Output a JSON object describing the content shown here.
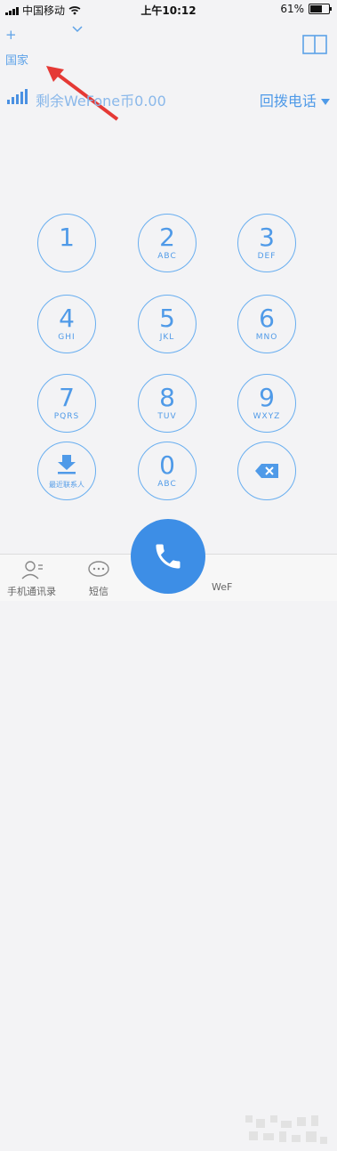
{
  "status_bar": {
    "carrier": "中国移动",
    "time": "上午10:12",
    "battery": "61%"
  },
  "header": {
    "plus": "+",
    "country": "国家"
  },
  "balance_row": {
    "balance_text": "剩余WeFone币0.00",
    "callback_text": "回拨电话"
  },
  "keypad": [
    {
      "digit": "1",
      "letters": ""
    },
    {
      "digit": "2",
      "letters": "ABC"
    },
    {
      "digit": "3",
      "letters": "DEF"
    },
    {
      "digit": "4",
      "letters": "GHI"
    },
    {
      "digit": "5",
      "letters": "JKL"
    },
    {
      "digit": "6",
      "letters": "MNO"
    },
    {
      "digit": "7",
      "letters": "PQRS"
    },
    {
      "digit": "8",
      "letters": "TUV"
    },
    {
      "digit": "9",
      "letters": "WXYZ"
    },
    {
      "digit": "0",
      "letters": "ABC"
    }
  ],
  "recent_label": "最近联系人",
  "bottom_tabs": {
    "contacts": "手机通讯录",
    "sms": "短信",
    "wefone": "WeF"
  },
  "colors": {
    "accent": "#4f9ae8",
    "call": "#3d8ee6",
    "arrow": "#e53935"
  }
}
